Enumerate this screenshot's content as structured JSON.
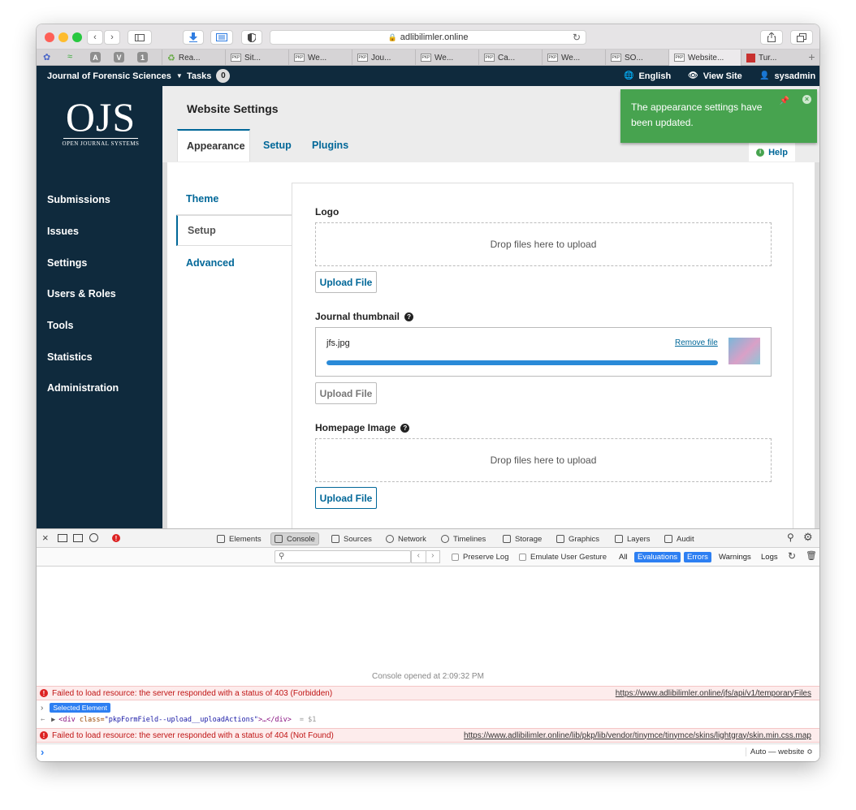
{
  "browser": {
    "url": "adlibilimler.online",
    "tabs": [
      "Rea...",
      "Sit...",
      "We...",
      "Jou...",
      "We...",
      "Ca...",
      "We...",
      "SO...",
      "Website...",
      "Tur..."
    ],
    "pinned": [
      "A",
      "V",
      "1"
    ]
  },
  "header": {
    "journal": "Journal of Forensic Sciences",
    "tasks_label": "Tasks",
    "tasks_count": "0",
    "language": "English",
    "view_site": "View Site",
    "user": "sysadmin"
  },
  "logo": {
    "big": "OJS",
    "small": "OPEN JOURNAL SYSTEMS"
  },
  "sidebar": {
    "items": [
      "Submissions",
      "Issues",
      "Settings",
      "Users & Roles",
      "Tools",
      "Statistics",
      "Administration"
    ]
  },
  "page": {
    "title": "Website Settings",
    "tabs": [
      "Appearance",
      "Setup",
      "Plugins"
    ],
    "help": "Help",
    "side_tabs": [
      "Theme",
      "Setup",
      "Advanced"
    ]
  },
  "form": {
    "logo_label": "Logo",
    "drop_text": "Drop files here to upload",
    "upload_label": "Upload File",
    "thumb_label": "Journal thumbnail",
    "thumb_file": "jfs.jpg",
    "remove_label": "Remove file",
    "thumb_progress": 1.0,
    "homepage_label": "Homepage Image"
  },
  "notification": {
    "text": "The appearance settings have been updated."
  },
  "devtools": {
    "tabs": [
      "Elements",
      "Console",
      "Sources",
      "Network",
      "Timelines",
      "Storage",
      "Graphics",
      "Layers",
      "Audit"
    ],
    "preserve_log": "Preserve Log",
    "emulate": "Emulate User Gesture",
    "levels": [
      "All",
      "Evaluations",
      "Errors",
      "Warnings",
      "Logs"
    ],
    "opened": "Console opened at 2:09:32 PM",
    "err1": "Failed to load resource: the server responded with a status of 403 (Forbidden)",
    "err1_url": "https://www.adlibilimler.online/jfs/api/v1/temporaryFiles",
    "selected": "Selected Element",
    "element_tag": "<div",
    "element_attr": "class=",
    "element_value": "\"pkpFormField--upload__uploadActions\"",
    "element_close": ">…</div>",
    "element_ref": "= $1",
    "err2": "Failed to load resource: the server responded with a status of 404 (Not Found)",
    "err2_url": "https://www.adlibilimler.online/lib/pkp/lib/vendor/tinymce/tinymce/skins/lightgray/skin.min.css.map",
    "context": "Auto — website ≎"
  }
}
